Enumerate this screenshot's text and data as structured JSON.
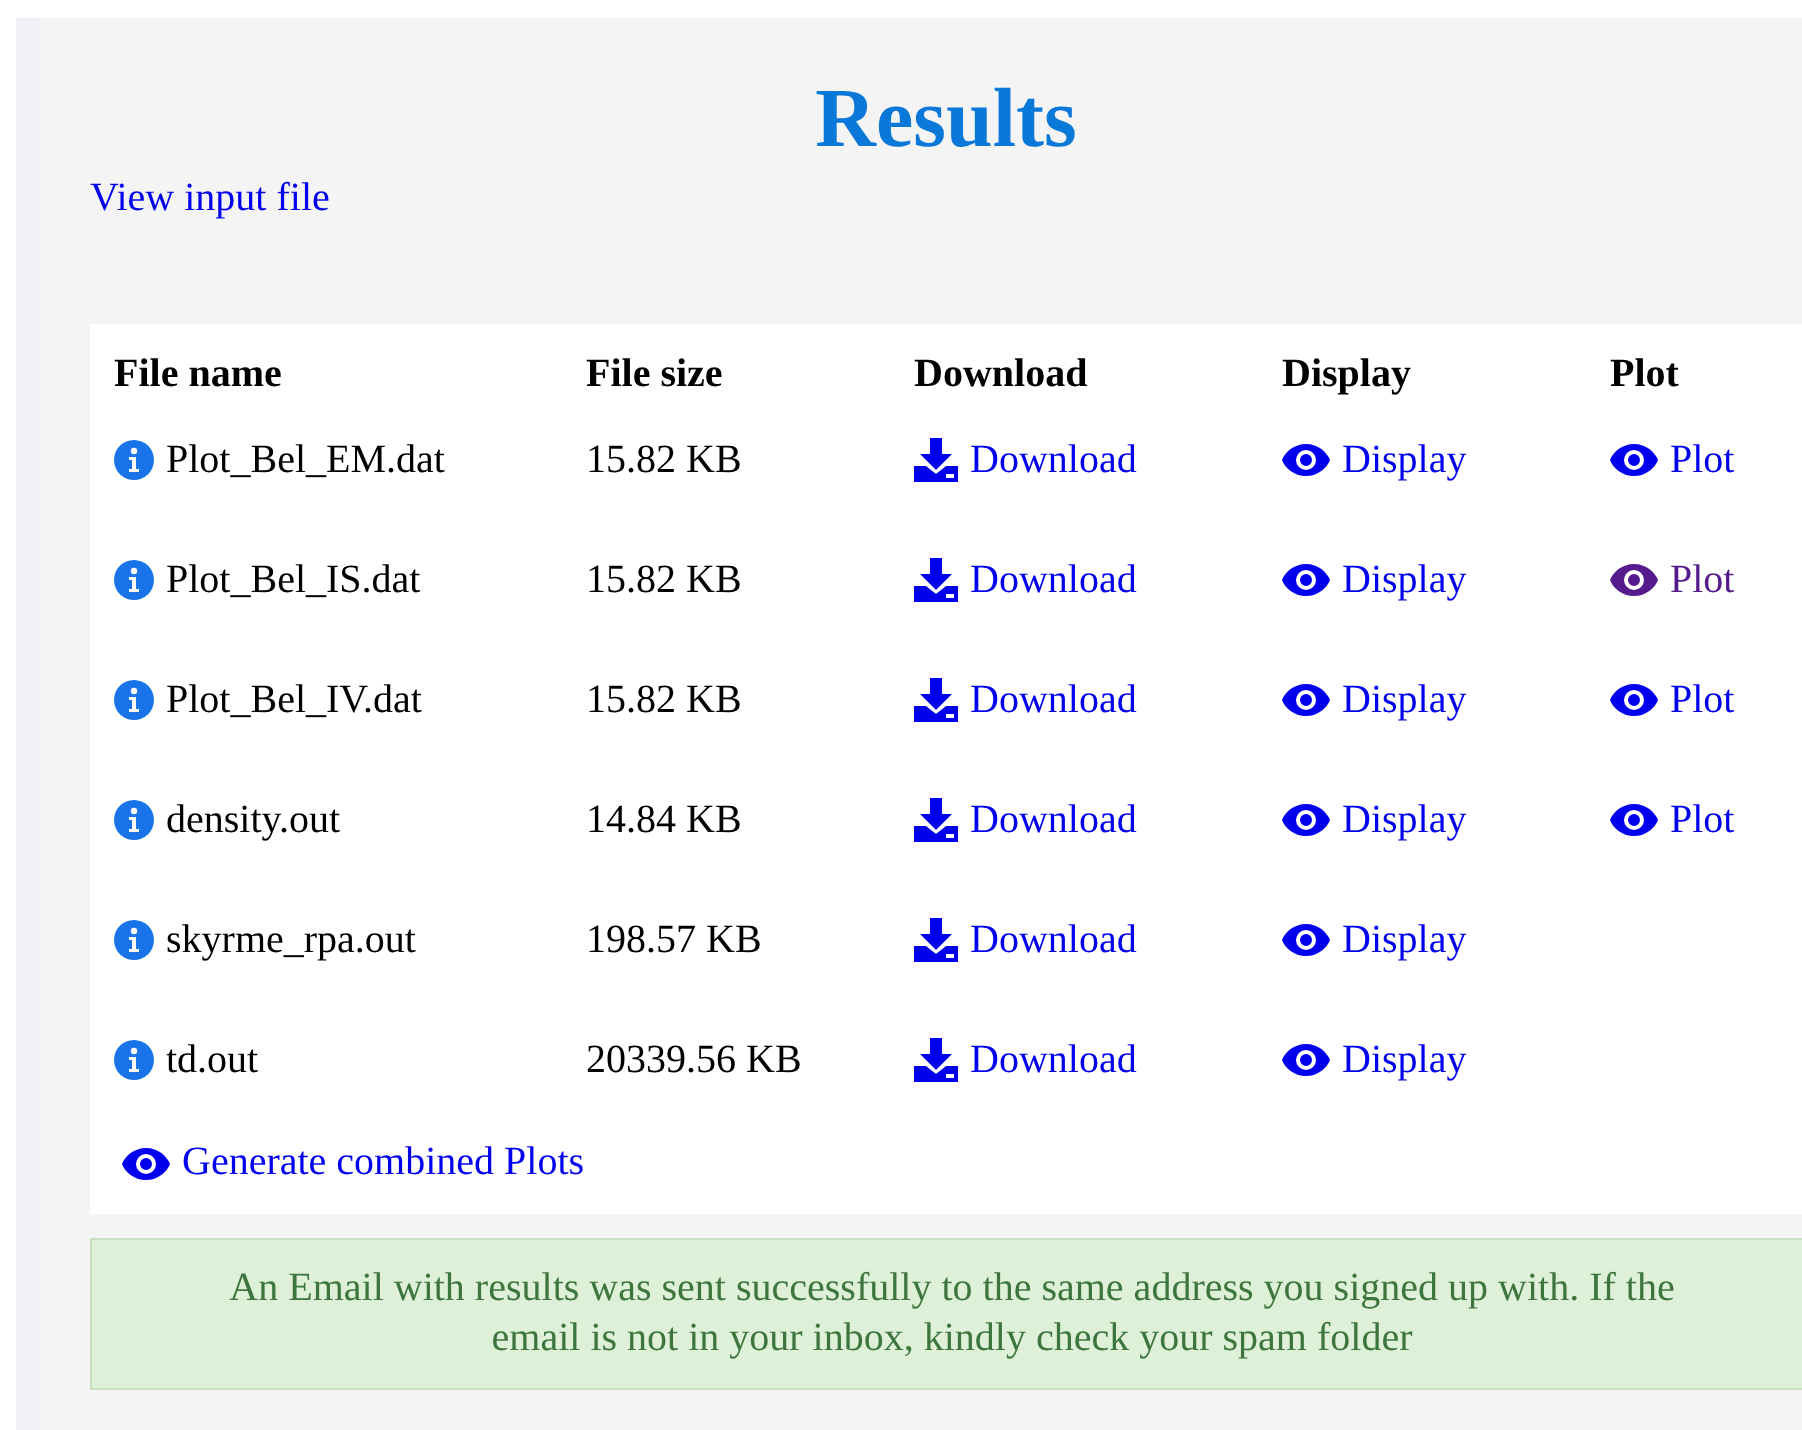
{
  "title": "Results",
  "input_link": "View input file",
  "table": {
    "columns": [
      "File name",
      "File size",
      "Download",
      "Display",
      "Plot"
    ],
    "rows": [
      {
        "name": "Plot_Bel_EM.dat",
        "size": "15.82 KB",
        "download": "Download",
        "display": "Display",
        "plot": {
          "label": "Plot",
          "visited": false
        }
      },
      {
        "name": "Plot_Bel_IS.dat",
        "size": "15.82 KB",
        "download": "Download",
        "display": "Display",
        "plot": {
          "label": "Plot",
          "visited": true
        }
      },
      {
        "name": "Plot_Bel_IV.dat",
        "size": "15.82 KB",
        "download": "Download",
        "display": "Display",
        "plot": {
          "label": "Plot",
          "visited": false
        }
      },
      {
        "name": "density.out",
        "size": "14.84 KB",
        "download": "Download",
        "display": "Display",
        "plot": {
          "label": "Plot",
          "visited": false
        }
      },
      {
        "name": "skyrme_rpa.out",
        "size": "198.57 KB",
        "download": "Download",
        "display": "Display"
      },
      {
        "name": "td.out",
        "size": "20339.56 KB",
        "download": "Download",
        "display": "Display"
      }
    ]
  },
  "combined_link": "Generate combined Plots",
  "alert": "An Email with results was sent successfully to the same address you signed up with. If the email is not in your inbox, kindly check your spam folder"
}
